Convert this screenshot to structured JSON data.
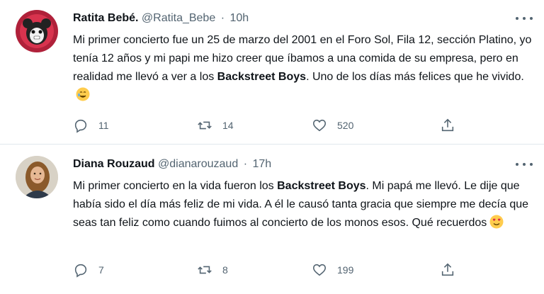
{
  "tweets": [
    {
      "name": "Ratita Bebé.",
      "handle": "@Ratita_Bebe",
      "separator": "·",
      "time": "10h",
      "text_parts": [
        "Mi primer concierto fue un 25 de marzo del 2001 en el Foro Sol, Fila 12, sección Platino, yo tenía 12 años y mi papi me hizo creer que íbamos a una comida de su empresa, pero en realidad me llevó a ver a los ",
        "Backstreet Boys",
        ". Uno de los días más felices que he vivido."
      ],
      "emoji": "crying-smile-emoji",
      "replies": "11",
      "retweets": "14",
      "likes": "520"
    },
    {
      "name": "Diana Rouzaud",
      "handle": "@dianarouzaud",
      "separator": "·",
      "time": "17h",
      "text_parts": [
        "Mi primer concierto en la vida fueron los ",
        "Backstreet Boys",
        ". Mi papá me llevó. Le dije que había sido el día más feliz de mi vida. A él le causó tanta gracia que siempre me decía que seas tan feliz como cuando fuimos al concierto de los monos esos. Qué recuerdos"
      ],
      "emoji": "heart-eyes-emoji",
      "replies": "7",
      "retweets": "8",
      "likes": "199"
    }
  ],
  "icons": {
    "reply": "reply-icon",
    "retweet": "retweet-icon",
    "like": "heart-icon",
    "share": "share-icon",
    "more": "more-dots-icon"
  },
  "colors": {
    "text": "#0f1419",
    "secondary": "#536471",
    "divider": "#e1e8ed",
    "emoji": "#ffcc4d"
  }
}
